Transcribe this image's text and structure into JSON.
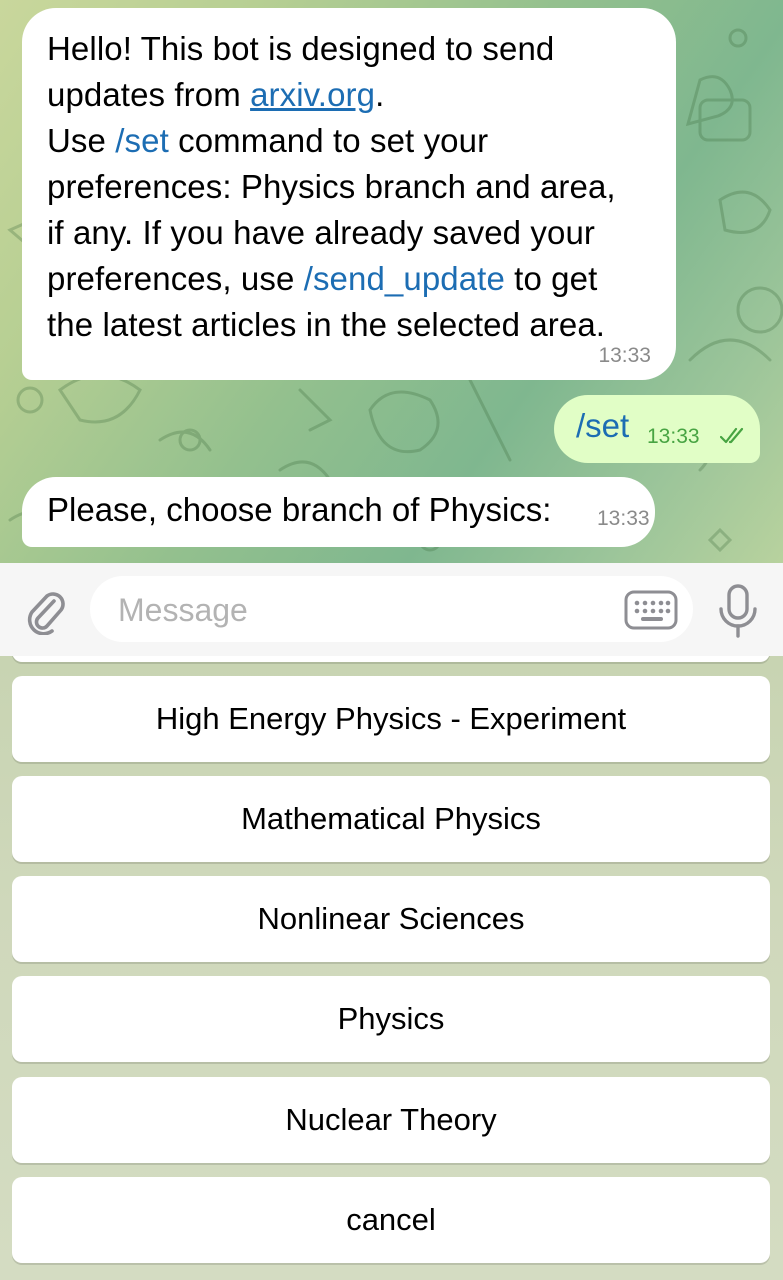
{
  "messages": {
    "welcome": {
      "line1": "Hello! This bot is designed to send",
      "line2_prefix": "updates from ",
      "link_text": "arxiv.org",
      "line2_suffix": ".",
      "line3_prefix": "Use ",
      "cmd_set": "/set",
      "line3_suffix": " command to set your",
      "line4": "preferences: Physics branch and area,",
      "line5": "if any. If you have already saved your",
      "line6_prefix": "preferences, use ",
      "cmd_send_update": "/send_update",
      "line6_suffix": " to get",
      "line7": "the latest articles in the selected area.",
      "time": "13:33"
    },
    "outgoing": {
      "text": "/set",
      "time": "13:33"
    },
    "prompt": {
      "text": "Please, choose branch of Physics:",
      "time": "13:33"
    }
  },
  "input": {
    "placeholder": "Message",
    "value": ""
  },
  "icons": {
    "attach": "paperclip-icon",
    "keyboard": "keyboard-icon",
    "mic": "microphone-icon",
    "read_receipt": "double-check-icon"
  },
  "reply_keyboard": {
    "buttons": [
      "High Energy Physics - Experiment",
      "Mathematical Physics",
      "Nonlinear Sciences",
      "Physics",
      "Nuclear Theory",
      "cancel"
    ]
  },
  "colors": {
    "link": "#1c6db3",
    "outgoing_bubble": "#e1fec6",
    "outgoing_time": "#47a442",
    "time_gray": "#8a8a8a"
  }
}
